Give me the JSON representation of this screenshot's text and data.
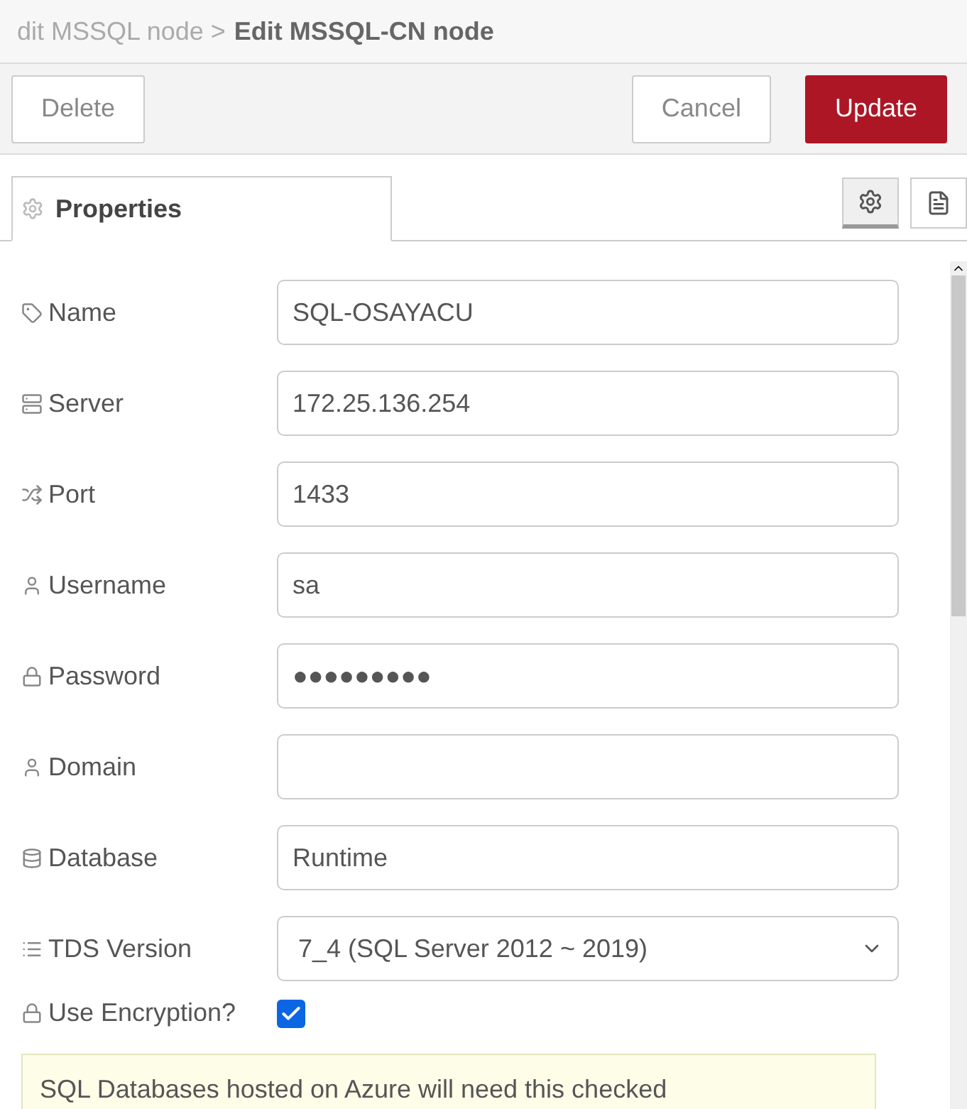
{
  "breadcrumb": {
    "parent": "dit MSSQL node >",
    "current": "Edit MSSQL-CN node"
  },
  "toolbar": {
    "delete": "Delete",
    "cancel": "Cancel",
    "update": "Update"
  },
  "tabs": [
    {
      "label": "Properties",
      "selected": true
    }
  ],
  "tab_buttons": [
    {
      "kind": "settings",
      "selected": true
    },
    {
      "kind": "description",
      "selected": false
    }
  ],
  "fields": [
    {
      "kind": "text",
      "label": "Name",
      "value": "SQL-OSAYACU"
    },
    {
      "kind": "text",
      "label": "Server",
      "value": "172.25.136.254"
    },
    {
      "kind": "text",
      "label": "Port",
      "value": "1433"
    },
    {
      "kind": "text",
      "label": "Username",
      "value": "sa"
    },
    {
      "kind": "text",
      "label": "Password",
      "value": "●●●●●●●●●"
    },
    {
      "kind": "text",
      "label": "Domain"
    },
    {
      "kind": "text",
      "label": "Database",
      "value": "Runtime"
    },
    {
      "kind": "select",
      "label": "TDS Version",
      "value": "7_4 (SQL Server 2012 ~ 2019)"
    },
    {
      "kind": "checkbox",
      "label": "Use Encryption?",
      "checked": true
    }
  ],
  "note": "SQL Databases hosted on Azure will need this checked"
}
